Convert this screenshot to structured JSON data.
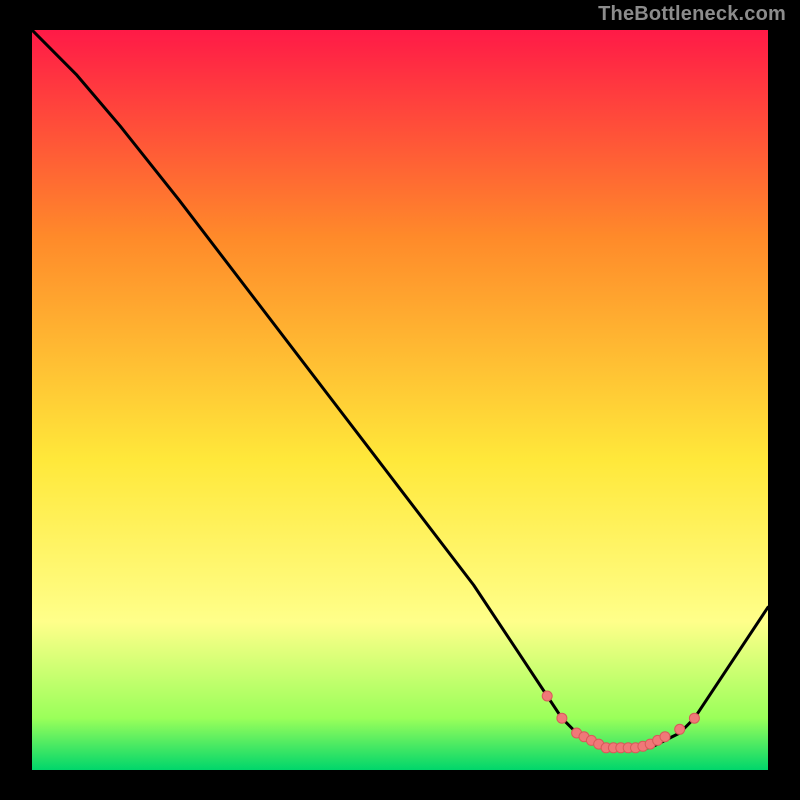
{
  "watermark": "TheBottleneck.com",
  "colors": {
    "bg": "#000000",
    "grad_top": "#ff1a47",
    "grad_mid1": "#ff8a2a",
    "grad_mid2": "#ffe83a",
    "grad_low": "#ffff8a",
    "grad_green1": "#9aff5a",
    "grad_green2": "#00d66b",
    "curve": "#000000",
    "marker_fill": "#f07878",
    "marker_stroke": "#d85a5a"
  },
  "chart_data": {
    "type": "line",
    "title": "",
    "xlabel": "",
    "ylabel": "",
    "xlim": [
      0,
      100
    ],
    "ylim": [
      0,
      100
    ],
    "series": [
      {
        "name": "bottleneck-curve",
        "x": [
          0,
          6,
          12,
          20,
          30,
          40,
          50,
          60,
          66,
          70,
          72,
          74,
          76,
          78,
          80,
          82,
          84,
          86,
          88,
          90,
          100
        ],
        "y": [
          100,
          94,
          87,
          77,
          64,
          51,
          38,
          25,
          16,
          10,
          7,
          5,
          4,
          3,
          3,
          3,
          3,
          4,
          5,
          7,
          22
        ]
      }
    ],
    "markers": {
      "name": "optimal-band",
      "x": [
        70,
        72,
        74,
        75,
        76,
        77,
        78,
        79,
        80,
        81,
        82,
        83,
        84,
        85,
        86,
        88,
        90
      ],
      "y": [
        10,
        7,
        5,
        4.5,
        4,
        3.5,
        3,
        3,
        3,
        3,
        3,
        3.2,
        3.5,
        4,
        4.5,
        5.5,
        7
      ]
    }
  }
}
